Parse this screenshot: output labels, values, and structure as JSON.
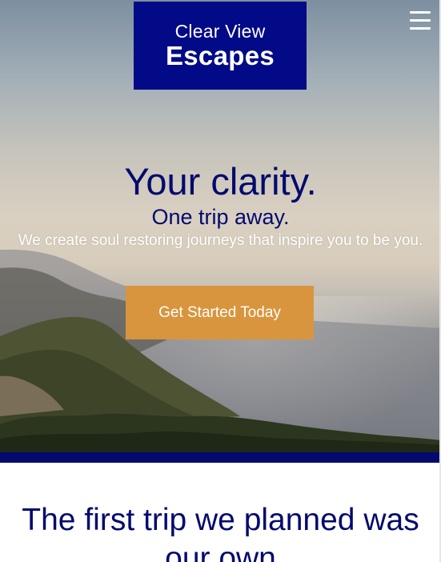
{
  "brand": {
    "line1": "Clear View",
    "line2": "Escapes",
    "color": "#020a87"
  },
  "nav": {
    "menu_icon": "hamburger-menu-icon"
  },
  "hero": {
    "headline": "Your clarity.",
    "subheadline": "One trip away.",
    "description": "We create soul restoring journeys that inspire you to be you.",
    "cta_label": "Get Started Today",
    "cta_color": "#d9953d",
    "text_color": "#020a6e"
  },
  "intro": {
    "title_light": "The first trip we planned ",
    "title_bold": "was our own"
  },
  "colors": {
    "accent_bar": "#020a6e",
    "background": "#ffffff"
  }
}
